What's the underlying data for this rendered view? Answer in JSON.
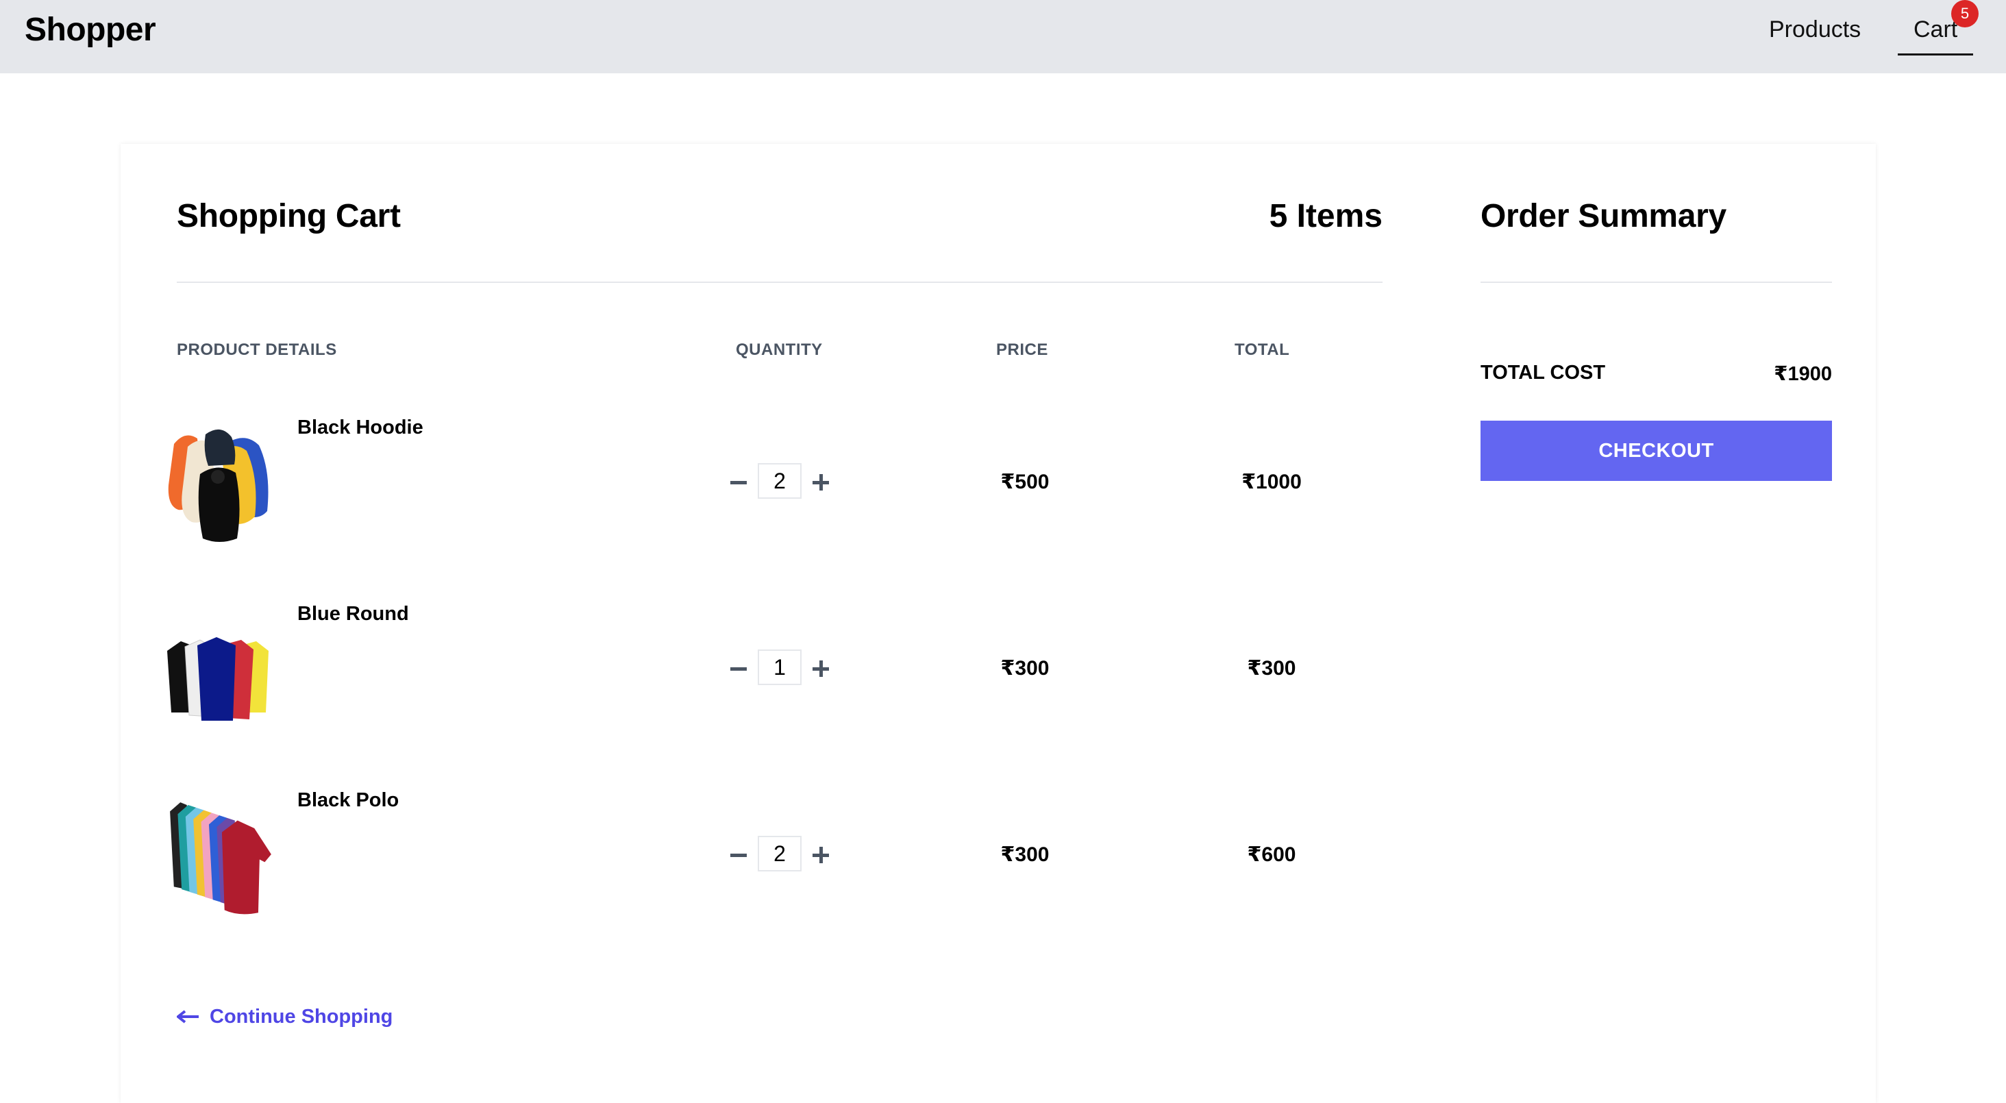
{
  "navbar": {
    "brand": "Shopper",
    "products_label": "Products",
    "cart_label": "Cart",
    "cart_badge": "5"
  },
  "cart": {
    "title": "Shopping Cart",
    "items_count": "5 Items",
    "columns": {
      "product": "PRODUCT DETAILS",
      "quantity": "QUANTITY",
      "price": "PRICE",
      "total": "TOTAL"
    },
    "items": [
      {
        "name": "Black Hoodie",
        "quantity": "2",
        "price": "₹500",
        "total": "₹1000",
        "image": "hoodies-image"
      },
      {
        "name": "Blue Round",
        "quantity": "1",
        "price": "₹300",
        "total": "₹300",
        "image": "round-tshirts-image"
      },
      {
        "name": "Black Polo",
        "quantity": "2",
        "price": "₹300",
        "total": "₹600",
        "image": "polo-shirts-image"
      }
    ],
    "continue_label": "Continue Shopping"
  },
  "summary": {
    "title": "Order Summary",
    "total_label": "TOTAL COST",
    "total_value": "₹1900",
    "checkout_label": "CHECKOUT"
  },
  "colors": {
    "accent": "#6366f1",
    "link": "#4f46e5",
    "badge": "#dc2626",
    "navbar_bg": "#e5e7eb"
  }
}
